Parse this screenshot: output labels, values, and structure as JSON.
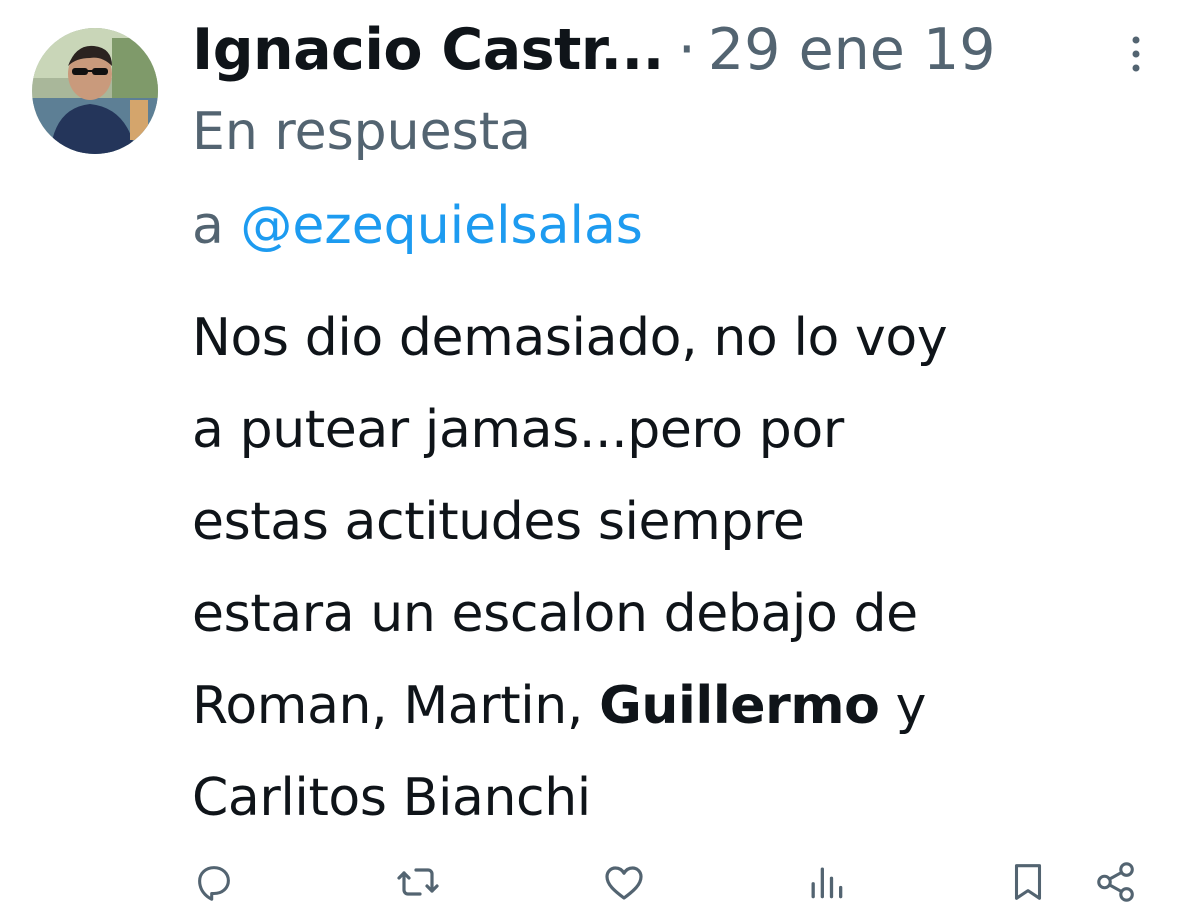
{
  "tweet": {
    "author_name": "Ignacio Castr...",
    "separator": "·",
    "date": "29 ene 19",
    "reply_prefix_line1": "En respuesta",
    "reply_prefix_line2": "a",
    "reply_mention": "@ezequielsalas",
    "body_lines": [
      "Nos dio demasiado, no lo voy",
      "a putear jamas...pero por",
      "estas actitudes siempre",
      "estara un escalon debajo de"
    ],
    "body_line5_part1": "Roman, Martin, ",
    "body_line5_bold": "Guillermo",
    "body_line5_part2": " y",
    "body_line6": "Carlitos Bianchi"
  },
  "actions": [
    {
      "name": "reply",
      "icon": "reply-icon"
    },
    {
      "name": "retweet",
      "icon": "retweet-icon"
    },
    {
      "name": "like",
      "icon": "heart-icon"
    },
    {
      "name": "views",
      "icon": "analytics-icon"
    },
    {
      "name": "bookmark",
      "icon": "bookmark-icon"
    },
    {
      "name": "share",
      "icon": "share-icon"
    }
  ],
  "colors": {
    "text_primary": "#0f1419",
    "text_secondary": "#536471",
    "link": "#1d9bf0",
    "background": "#ffffff"
  }
}
